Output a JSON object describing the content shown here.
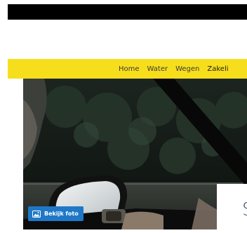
{
  "navigation": {
    "items": [
      {
        "label": "Home"
      },
      {
        "label": "Water"
      },
      {
        "label": "Wegen"
      },
      {
        "label": "Zakeli"
      }
    ]
  },
  "hero": {
    "photo_button_label": "Bekijk foto",
    "photo_button_icon": "image-icon",
    "headline_partial": "S"
  },
  "colors": {
    "nav_background": "#f7de1c",
    "button_background": "#1f78c7",
    "top_bar": "#000000"
  }
}
